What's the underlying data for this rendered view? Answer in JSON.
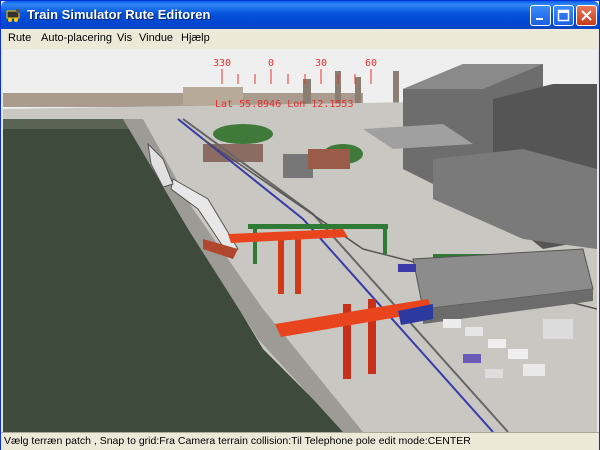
{
  "window": {
    "title": "Train Simulator Rute Editoren",
    "controls": {
      "minimize": "minimize",
      "maximize": "maximize",
      "close": "close"
    }
  },
  "menu": {
    "items": [
      {
        "label": "Rute"
      },
      {
        "label": "Auto-placering"
      },
      {
        "label": "Vis"
      },
      {
        "label": "Vindue"
      },
      {
        "label": "Hjælp"
      }
    ]
  },
  "viewport": {
    "compass": {
      "headings": [
        "330",
        "0",
        "30",
        "60"
      ],
      "position_readout": "Lat 55.8946 Lon 12.1553"
    },
    "scene_colors": {
      "water": "#3e4a3c",
      "crane": "#e8451f",
      "gantry": "#2f7a34",
      "ground": "#c9c7c2"
    }
  },
  "status": {
    "text": "Vælg terræn patch , Snap to grid:Fra Camera terrain collision:Til Telephone pole edit mode:CENTER"
  }
}
